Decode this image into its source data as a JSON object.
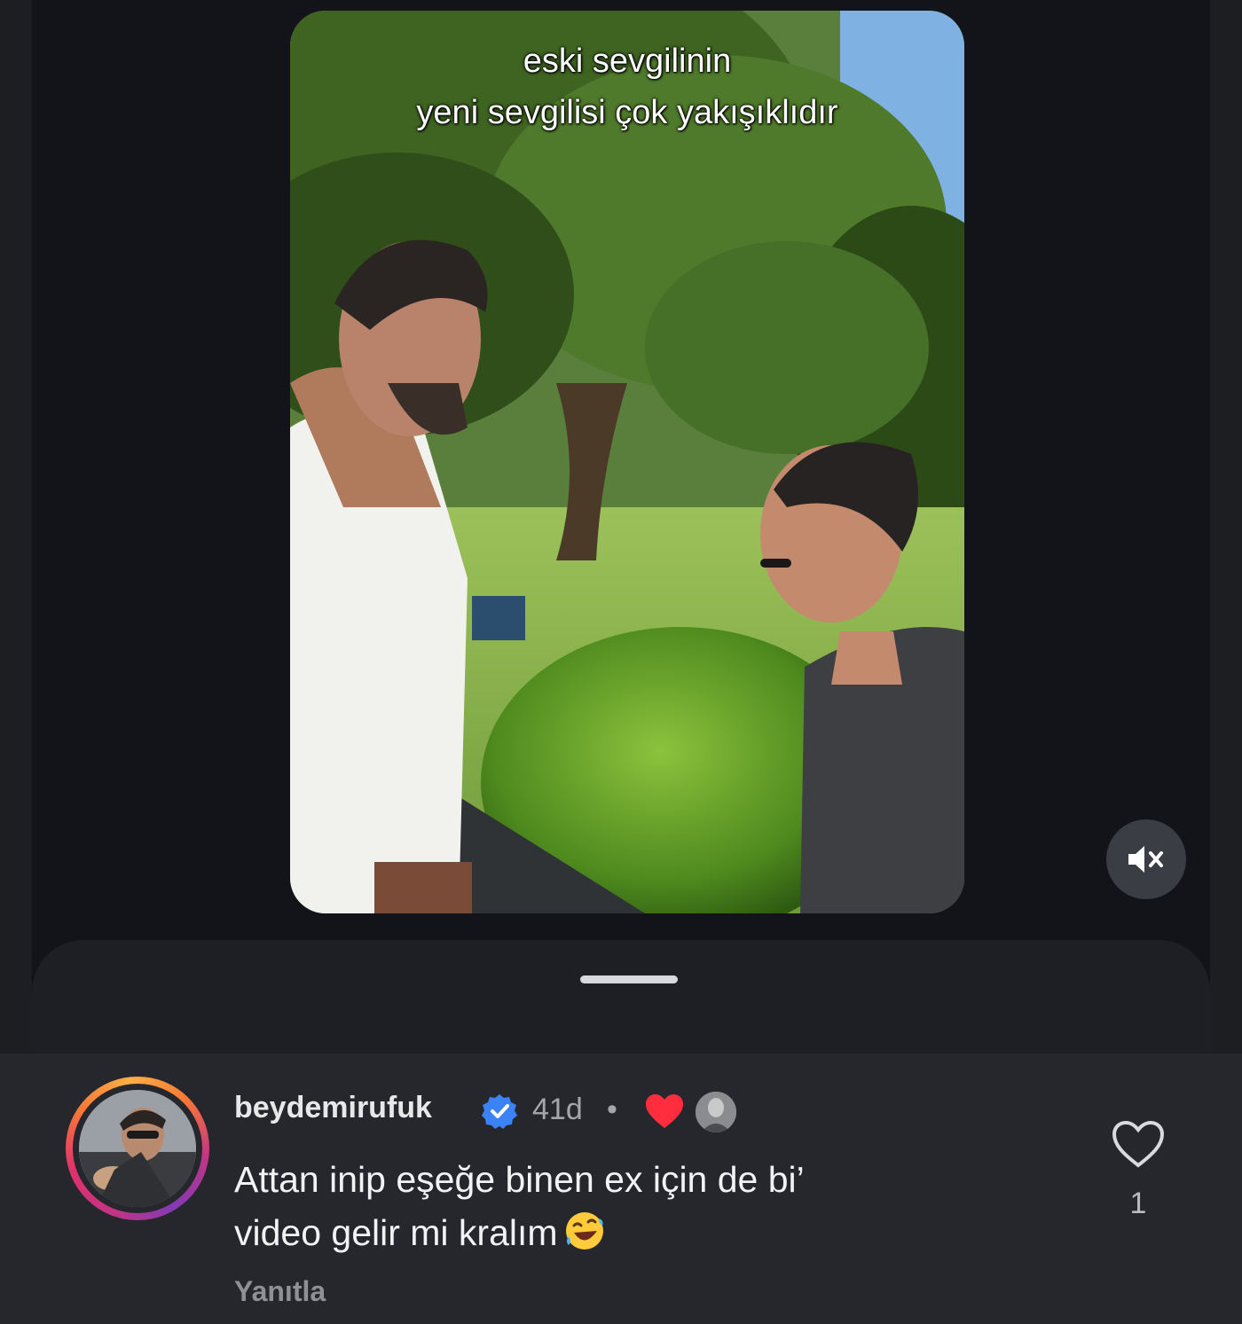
{
  "video": {
    "caption_line1": "eski sevgilinin",
    "caption_line2": "yeni sevgilisi çok yakışıklıdır",
    "mute_icon": "speaker-muted-icon"
  },
  "comment": {
    "username": "beydemirufuk",
    "verified_icon": "verified-badge-icon",
    "age": "41d",
    "separator": "•",
    "creator_liked_icon": "heart-filled-icon",
    "text_line1": "Attan inip eşeğe binen ex için de bi’",
    "text_line2": "video gelir mi kralım",
    "emoji": "rolling-on-floor-laughing-emoji",
    "reply_label": "Yanıtla",
    "like_icon": "heart-outline-icon",
    "like_count": "1"
  },
  "colors": {
    "background": "#101115",
    "sheet": "#1d1f24",
    "comment_bg": "#26272c",
    "verified_blue": "#3b82f6",
    "liked_red": "#ff2d3d"
  }
}
